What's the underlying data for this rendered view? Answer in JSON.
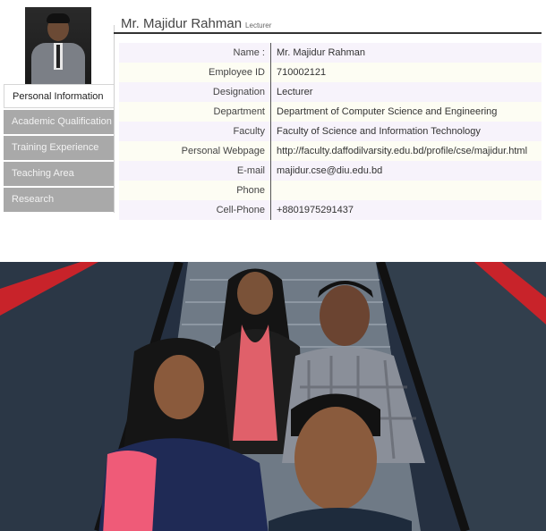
{
  "profile": {
    "name": "Mr. Majidur Rahman",
    "designation_tag": "Lecturer"
  },
  "nav": {
    "items": [
      {
        "label": "Personal Information",
        "active": true
      },
      {
        "label": "Academic Qualification",
        "active": false
      },
      {
        "label": "Training Experience",
        "active": false
      },
      {
        "label": "Teaching Area",
        "active": false
      },
      {
        "label": "Research",
        "active": false
      }
    ]
  },
  "info": {
    "rows": [
      {
        "label": "Name :",
        "value": "Mr. Majidur Rahman"
      },
      {
        "label": "Employee ID",
        "value": "710002121"
      },
      {
        "label": "Designation",
        "value": "Lecturer"
      },
      {
        "label": "Department",
        "value": "Department of Computer Science and Engineering"
      },
      {
        "label": "Faculty",
        "value": "Faculty of Science and Information Technology"
      },
      {
        "label": "Personal Webpage",
        "value": "http://faculty.daffodilvarsity.edu.bd/profile/cse/majidur.html"
      },
      {
        "label": "E-mail",
        "value": "majidur.cse@diu.edu.bd"
      },
      {
        "label": "Phone",
        "value": ""
      },
      {
        "label": "Cell-Phone",
        "value": "+8801975291437"
      }
    ]
  },
  "colors": {
    "nav_bg": "#a9a9a9",
    "row_odd": "#f7f3fb",
    "row_even": "#fdfdf3",
    "escalator_rail": "#c8232a"
  }
}
